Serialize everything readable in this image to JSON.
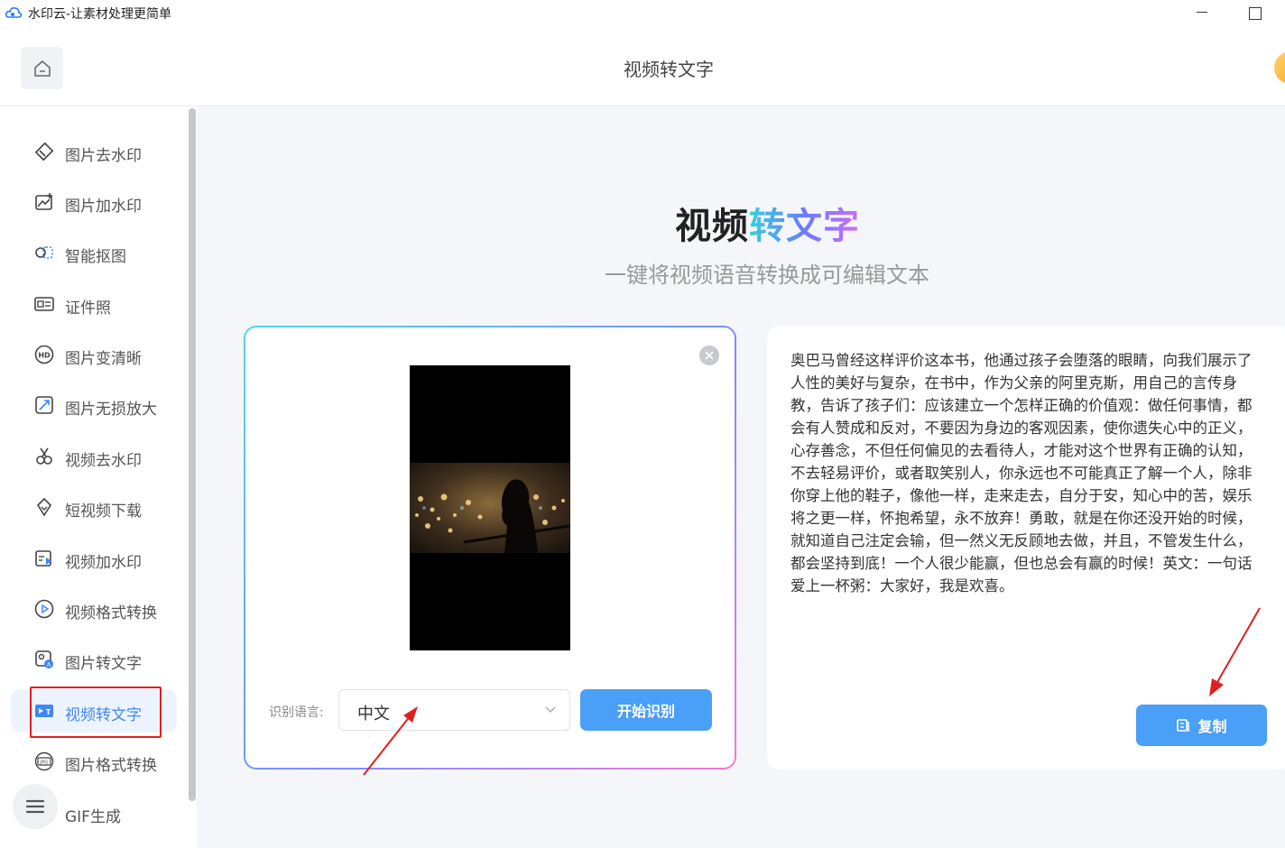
{
  "window": {
    "title": "水印云-让素材处理更简单"
  },
  "header": {
    "title": "视频转文字"
  },
  "sidebar": {
    "items": [
      {
        "label": "图片去水印",
        "icon": "eraser-icon"
      },
      {
        "label": "图片加水印",
        "icon": "image-add-icon"
      },
      {
        "label": "智能抠图",
        "icon": "cutout-icon"
      },
      {
        "label": "证件照",
        "icon": "id-card-icon"
      },
      {
        "label": "图片变清晰",
        "icon": "hd-icon"
      },
      {
        "label": "图片无损放大",
        "icon": "enlarge-icon"
      },
      {
        "label": "视频去水印",
        "icon": "video-eraser-icon"
      },
      {
        "label": "短视频下载",
        "icon": "download-icon"
      },
      {
        "label": "视频加水印",
        "icon": "video-add-icon"
      },
      {
        "label": "视频格式转换",
        "icon": "play-circle-icon"
      },
      {
        "label": "图片转文字",
        "icon": "image-text-icon"
      },
      {
        "label": "视频转文字",
        "icon": "video-text-icon",
        "active": true
      },
      {
        "label": "图片格式转换",
        "icon": "jpg-icon"
      },
      {
        "label": "GIF生成",
        "icon": "gif-icon"
      }
    ]
  },
  "hero": {
    "title_part1": "视频",
    "title_part2": "转文字",
    "subtitle": "一键将视频语音转换成可编辑文本"
  },
  "upload": {
    "language_label": "识别语言:",
    "language_value": "中文",
    "start_button": "开始识别"
  },
  "result": {
    "text": "奥巴马曾经这样评价这本书，他通过孩子会堕落的眼睛，向我们展示了人性的美好与复杂，在书中，作为父亲的阿里克斯，用自己的言传身教，告诉了孩子们：应该建立一个怎样正确的价值观：做任何事情，都会有人赞成和反对，不要因为身边的客观因素，使你遗失心中的正义，心存善念，不但任何偏见的去看待人，才能对这个世界有正确的认知，不去轻易评价，或者取笑别人，你永远也不可能真正了解一个人，除非你穿上他的鞋子，像他一样，走来走去，自分于安，知心中的苦，娱乐将之更一样，怀抱希望，永不放弃！勇敢，就是在你还没开始的时候，就知道自己注定会输，但一然义无反顾地去做，并且，不管发生什么，都会坚持到底！一个人很少能赢，但也总会有赢的时候！英文：一句话爱上一杯粥：大家好，我是欢喜。",
    "copy_button": "复制"
  },
  "colors": {
    "accent": "#4a9ff7",
    "active_text": "#3f87f5",
    "annotation": "#e02020"
  }
}
